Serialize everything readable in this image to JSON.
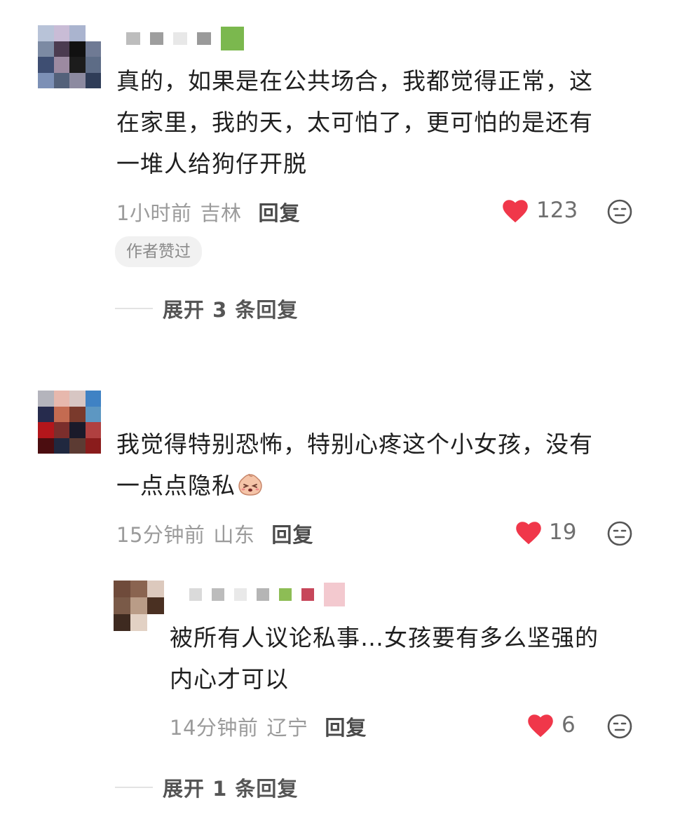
{
  "comments": [
    {
      "text_lines": [
        "真的，如果是在公共场合，我都觉得正常，这",
        "在家里，我的天，太可怕了，更可怕的是还有",
        "一堆人给狗仔开脱"
      ],
      "time": "1小时前",
      "location": "吉林",
      "reply_label": "回复",
      "likes": "123",
      "badge": "作者赞过",
      "expand_label": "展开 3 条回复",
      "avatar_colors": [
        "#b8c3d8",
        "#c9bcd6",
        "#aab4cf",
        "#ffffff",
        "#7c8aa3",
        "#4b3b50",
        "#111111",
        "#6f7a94",
        "#3e4e72",
        "#9c8aa1",
        "#1c1c1c",
        "#5d6c86",
        "#7c90b6",
        "#53617a",
        "#8c8aa0",
        "#2f3d58",
        "#616e8a",
        "#1d1d1d",
        "#566481",
        "#2c3a54"
      ],
      "name_colors": [
        "#bdbdbd",
        "#9e9e9e",
        "#e8e8e8",
        "#9a9a9a",
        "#7bb84e"
      ]
    },
    {
      "text_lines": [
        "我觉得特别恐怖，特别心疼这个小女孩，没有",
        "一点点隐私"
      ],
      "time": "15分钟前",
      "location": "山东",
      "reply_label": "回复",
      "likes": "19",
      "avatar_colors": [
        "#b4b4bc",
        "#e7b8ad",
        "#d7c6c3",
        "#3f82c4",
        "#262b4d",
        "#c46b51",
        "#7a3a2c",
        "#5d97c2",
        "#b3161b",
        "#7b2e2c",
        "#1a1a2a",
        "#b04040",
        "#4b0d10",
        "#20283f",
        "#5c3b33",
        "#8a1c1c",
        "#9d9da5",
        "#6a6066",
        "#a02b2b",
        "#ffffff"
      ],
      "name_colors": []
    }
  ],
  "reply": {
    "text_lines": [
      "被所有人议论私事…女孩要有多么坚强的",
      "内心才可以"
    ],
    "time": "14分钟前",
    "location": "辽宁",
    "reply_label": "回复",
    "likes": "6",
    "avatar_colors": [
      "#6f4b3b",
      "#8a6450",
      "#dcc9bd",
      "#7a5a48",
      "#b99c87",
      "#4a3022",
      "#3e2a20",
      "#e2d1c4",
      "#ffffff"
    ],
    "name_colors": [
      "#dadada",
      "#bcbcbc",
      "#e9e9e9",
      "#b5b5b5",
      "#8dbd55",
      "#c7475a",
      "#f3c9cf"
    ]
  },
  "expand2_label": "展开 1 条回复",
  "colors": {
    "heart": "#f0374a",
    "meta": "#9b9b9b"
  },
  "icons": {
    "like": "heart-icon",
    "emoji": "emoji-face-icon",
    "sticker": "crying-peach-emoji-icon"
  }
}
